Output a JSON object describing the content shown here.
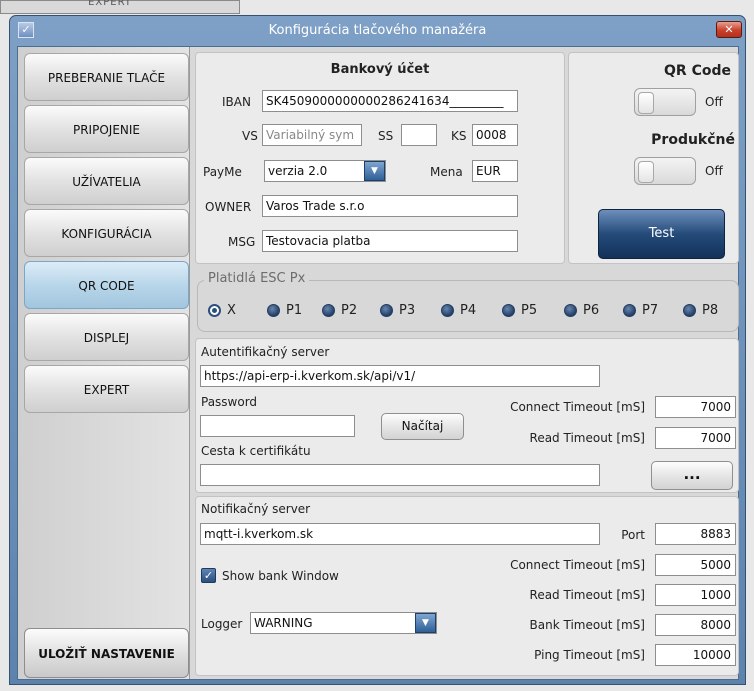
{
  "background_window": {
    "tab_label": "EXPERT"
  },
  "dialog": {
    "title": "Konfigurácia tlačového manažéra",
    "close_icon": "close-icon",
    "app_icon": "checkmark-app-icon"
  },
  "sidebar": {
    "items": [
      {
        "label": "PREBERANIE TLAČE",
        "active": false
      },
      {
        "label": "PRIPOJENIE",
        "active": false
      },
      {
        "label": "UŽÍVATELIA",
        "active": false
      },
      {
        "label": "KONFIGURÁCIA",
        "active": false
      },
      {
        "label": "QR CODE",
        "active": true
      },
      {
        "label": "DISPLEJ",
        "active": false
      },
      {
        "label": "EXPERT",
        "active": false
      }
    ],
    "save_label": "ULOŽIŤ NASTAVENIE"
  },
  "bank": {
    "heading": "Bankový účet",
    "iban_label": "IBAN",
    "iban_value": "SK4509000000000286241634_________",
    "vs_label": "VS",
    "vs_placeholder": "Variabilný sym",
    "ss_label": "SS",
    "ss_value": "",
    "ks_label": "KS",
    "ks_value": "0008",
    "payme_label": "PayMe",
    "payme_value": "verzia 2.0",
    "mena_label": "Mena",
    "mena_value": "EUR",
    "owner_label": "OWNER",
    "owner_value": "Varos Trade s.r.o",
    "msg_label": "MSG",
    "msg_value": "Testovacia platba"
  },
  "qr": {
    "qr_heading": "QR Code",
    "qr_toggle_label": "Off",
    "prod_heading": "Produkčné",
    "prod_toggle_label": "Off",
    "test_label": "Test"
  },
  "esc": {
    "legend": "Platidlá ESC Px",
    "options": [
      "X",
      "P1",
      "P2",
      "P3",
      "P4",
      "P5",
      "P6",
      "P7",
      "P8"
    ],
    "selected": "X"
  },
  "auth": {
    "server_label": "Autentifikačný server",
    "server_value": "https://api-erp-i.kverkom.sk/api/v1/",
    "password_label": "Password",
    "password_value": "",
    "load_label": "Načítaj",
    "cert_label": "Cesta k certifikátu",
    "cert_value": "",
    "browse_label": "...",
    "connect_timeout_label": "Connect Timeout [mS]",
    "connect_timeout_value": "7000",
    "read_timeout_label": "Read Timeout [mS]",
    "read_timeout_value": "7000"
  },
  "notif": {
    "server_label": "Notifikačný server",
    "server_value": "mqtt-i.kverkom.sk",
    "port_label": "Port",
    "port_value": "8883",
    "show_bank_label": "Show bank Window",
    "show_bank_checked": true,
    "logger_label": "Logger",
    "logger_value": "WARNING",
    "connect_timeout_label": "Connect Timeout [mS]",
    "connect_timeout_value": "5000",
    "read_timeout_label": "Read Timeout [mS]",
    "read_timeout_value": "1000",
    "bank_timeout_label": "Bank Timeout [mS]",
    "bank_timeout_value": "8000",
    "ping_timeout_label": "Ping Timeout [mS]",
    "ping_timeout_value": "10000"
  },
  "colors": {
    "accent": "#2b507f",
    "active_tab": "#b9d6ea",
    "title_bar": "#6d90b8"
  }
}
